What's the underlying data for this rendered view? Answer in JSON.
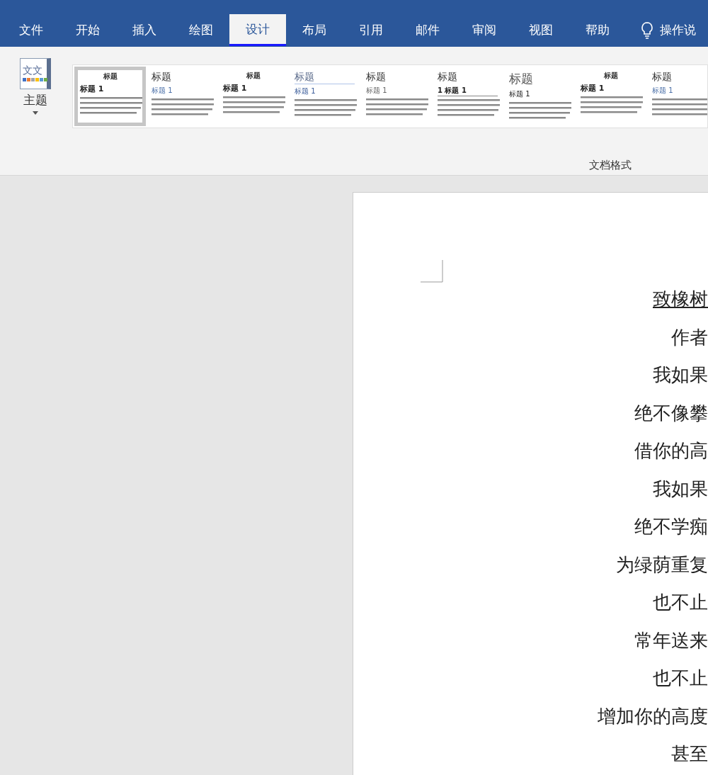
{
  "menu_tabs": [
    {
      "label": "文件",
      "selected": false
    },
    {
      "label": "开始",
      "selected": false
    },
    {
      "label": "插入",
      "selected": false
    },
    {
      "label": "绘图",
      "selected": false
    },
    {
      "label": "设计",
      "selected": true
    },
    {
      "label": "布局",
      "selected": false
    },
    {
      "label": "引用",
      "selected": false
    },
    {
      "label": "邮件",
      "selected": false
    },
    {
      "label": "审阅",
      "selected": false
    },
    {
      "label": "视图",
      "selected": false
    },
    {
      "label": "帮助",
      "selected": false
    }
  ],
  "tell_me": {
    "label": "操作说"
  },
  "ribbon": {
    "theme_button": {
      "label": "主题",
      "icon_text": "文文"
    },
    "style_gallery": [
      {
        "kind": "centered",
        "title": "标题",
        "heading": "标题 1",
        "selected": true
      },
      {
        "kind": "accent",
        "title": "标题",
        "heading": "标题 1",
        "selected": false
      },
      {
        "kind": "centered",
        "title": "标题",
        "heading": "标题 1",
        "selected": false
      },
      {
        "kind": "rule",
        "title": "标题",
        "heading": "标题 1",
        "selected": false
      },
      {
        "kind": "plain",
        "title": "标题",
        "heading": "标题 1",
        "selected": false
      },
      {
        "kind": "numbered",
        "title": "标题",
        "heading": "1  标题 1",
        "selected": false
      },
      {
        "kind": "large",
        "title": "标题",
        "heading": "标题 1",
        "selected": false
      },
      {
        "kind": "centered",
        "title": "标题",
        "heading": "标题 1",
        "selected": false
      },
      {
        "kind": "accent",
        "title": "标题",
        "heading": "标题 1",
        "selected": false
      }
    ],
    "group_label": "文档格式"
  },
  "document": {
    "title": "致橡树",
    "lines": [
      "作者",
      "我如果",
      "绝不像攀",
      "借你的高",
      "我如果",
      "绝不学痴",
      "为绿荫重复",
      "也不止",
      "常年送来",
      "也不止",
      "增加你的高度",
      "甚至"
    ]
  }
}
